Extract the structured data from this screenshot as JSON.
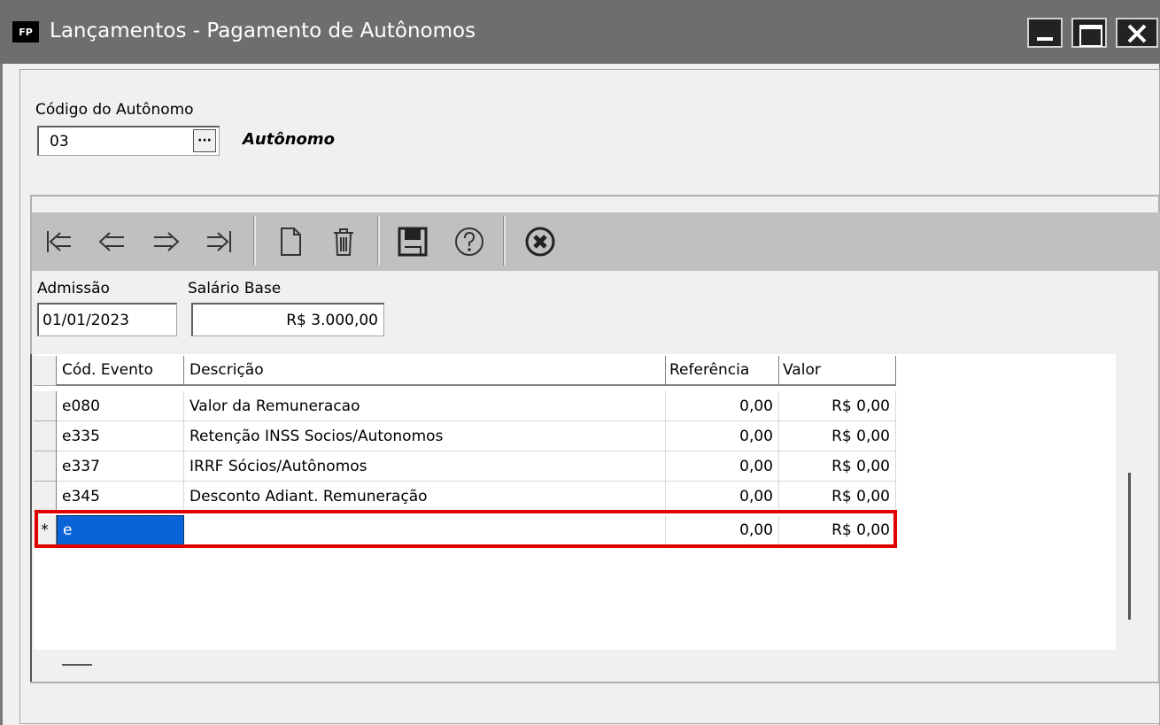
{
  "window": {
    "app_badge": "FP",
    "title": "Lançamentos  - Pagamento de Autônomos"
  },
  "autonomo": {
    "code_label": "Código do Autônomo",
    "code_value": "03",
    "lookup_button": "···",
    "name": "Autônomo"
  },
  "toolbar": {
    "icons": [
      "first-record-icon",
      "previous-record-icon",
      "next-record-icon",
      "last-record-icon",
      "new-record-icon",
      "delete-icon",
      "save-icon",
      "help-icon",
      "cancel-icon"
    ]
  },
  "form": {
    "admissao_label": "Admissão",
    "admissao_value": "01/01/2023",
    "salario_label": "Salário Base",
    "salario_value": "R$ 3.000,00"
  },
  "grid": {
    "headers": [
      "Cód. Evento",
      "Descrição",
      "Referência",
      "Valor"
    ],
    "rows": [
      {
        "code": "e080",
        "desc": "Valor da Remuneracao",
        "ref": "0,00",
        "valor": "R$ 0,00"
      },
      {
        "code": "e335",
        "desc": "Retenção INSS Socios/Autonomos",
        "ref": "0,00",
        "valor": "R$ 0,00"
      },
      {
        "code": "e337",
        "desc": "IRRF Sócios/Autônomos",
        "ref": "0,00",
        "valor": "R$ 0,00"
      },
      {
        "code": "e345",
        "desc": "Desconto Adiant. Remuneração",
        "ref": "0,00",
        "valor": "R$ 0,00"
      }
    ],
    "new_row": {
      "indicator": "*",
      "code": "e",
      "desc": "",
      "ref": "0,00",
      "valor": "R$ 0,00"
    }
  },
  "colors": {
    "titlebar": "#6e6e6e",
    "toolbar": "#c0c0c0",
    "selection": "#0a64d8",
    "highlight": "#e00000"
  }
}
